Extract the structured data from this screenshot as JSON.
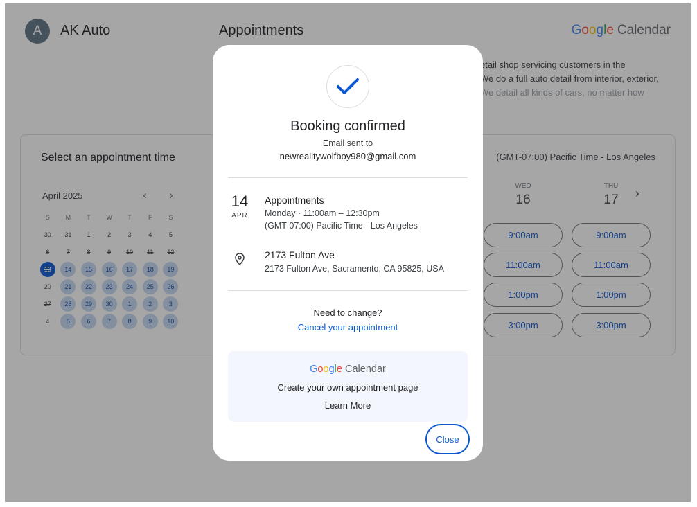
{
  "header": {
    "avatar_letter": "A",
    "business_name": "AK Auto",
    "page_title": "Appointments",
    "logo": {
      "g_letters": [
        "G",
        "o",
        "o",
        "g",
        "l",
        "e"
      ],
      "g_colors": [
        "#4285f4",
        "#ea4335",
        "#fbbc05",
        "#4285f4",
        "#34a853",
        "#ea4335"
      ],
      "calendar_word": "Calendar"
    }
  },
  "description": {
    "lines": [
      "etail shop servicing customers in the",
      "We do a full auto detail from interior, exterior,",
      "We detail all kinds of cars, no matter how"
    ]
  },
  "booking": {
    "select_title": "Select an appointment time",
    "timezone": "(GMT-07:00) Pacific Time - Los Angeles",
    "month_label": "April 2025",
    "prev_icon": "chevron-left-icon",
    "next_icon": "chevron-right-icon",
    "weekdays": [
      "S",
      "M",
      "T",
      "W",
      "T",
      "F",
      "S"
    ],
    "days": [
      {
        "n": "30",
        "s": "past"
      },
      {
        "n": "31",
        "s": "past"
      },
      {
        "n": "1",
        "s": "past"
      },
      {
        "n": "2",
        "s": "past"
      },
      {
        "n": "3",
        "s": "past"
      },
      {
        "n": "4",
        "s": "past"
      },
      {
        "n": "5",
        "s": "past"
      },
      {
        "n": "6",
        "s": "past"
      },
      {
        "n": "7",
        "s": "past"
      },
      {
        "n": "8",
        "s": "past"
      },
      {
        "n": "9",
        "s": "past"
      },
      {
        "n": "10",
        "s": "past"
      },
      {
        "n": "11",
        "s": "past"
      },
      {
        "n": "12",
        "s": "past"
      },
      {
        "n": "13",
        "s": "today"
      },
      {
        "n": "14",
        "s": "avail"
      },
      {
        "n": "15",
        "s": "avail"
      },
      {
        "n": "16",
        "s": "avail"
      },
      {
        "n": "17",
        "s": "avail"
      },
      {
        "n": "18",
        "s": "avail"
      },
      {
        "n": "19",
        "s": "avail"
      },
      {
        "n": "20",
        "s": "past"
      },
      {
        "n": "21",
        "s": "avail"
      },
      {
        "n": "22",
        "s": "avail"
      },
      {
        "n": "23",
        "s": "avail"
      },
      {
        "n": "24",
        "s": "avail"
      },
      {
        "n": "25",
        "s": "avail"
      },
      {
        "n": "26",
        "s": "avail"
      },
      {
        "n": "27",
        "s": "past"
      },
      {
        "n": "28",
        "s": "avail"
      },
      {
        "n": "29",
        "s": "avail"
      },
      {
        "n": "30",
        "s": "avail"
      },
      {
        "n": "1",
        "s": "avail"
      },
      {
        "n": "2",
        "s": "avail"
      },
      {
        "n": "3",
        "s": "avail"
      },
      {
        "n": "4",
        "s": "plain"
      },
      {
        "n": "5",
        "s": "avail"
      },
      {
        "n": "6",
        "s": "avail"
      },
      {
        "n": "7",
        "s": "avail"
      },
      {
        "n": "8",
        "s": "avail"
      },
      {
        "n": "9",
        "s": "avail"
      },
      {
        "n": "10",
        "s": "avail"
      }
    ],
    "week_days": [
      {
        "dow": "WED",
        "num": "16",
        "slots": [
          "9:00am",
          "11:00am",
          "1:00pm",
          "3:00pm"
        ]
      },
      {
        "dow": "THU",
        "num": "17",
        "slots": [
          "9:00am",
          "11:00am",
          "1:00pm",
          "3:00pm"
        ]
      }
    ],
    "week_next_icon": "chevron-right-icon"
  },
  "modal": {
    "check_icon": "check-icon",
    "title": "Booking confirmed",
    "email_sent": "Email sent to",
    "email": "newrealitywolfboy980@gmail.com",
    "date_day": "14",
    "date_month": "APR",
    "appointment_name": "Appointments",
    "appointment_time": "Monday · 11:00am – 12:30pm",
    "appointment_tz": "(GMT-07:00) Pacific Time - Los Angeles",
    "pin_icon": "location-pin-icon",
    "location_name": "2173 Fulton Ave",
    "location_address": "2173 Fulton Ave, Sacramento, CA 95825, USA",
    "need_change": "Need to change?",
    "cancel_link": "Cancel your appointment",
    "promo_text": "Create your own appointment page",
    "learn_more": "Learn More",
    "close_label": "Close"
  },
  "colors": {
    "accent": "#0b57d0",
    "available_day": "#c5d8f1",
    "overlay": "#202124"
  }
}
